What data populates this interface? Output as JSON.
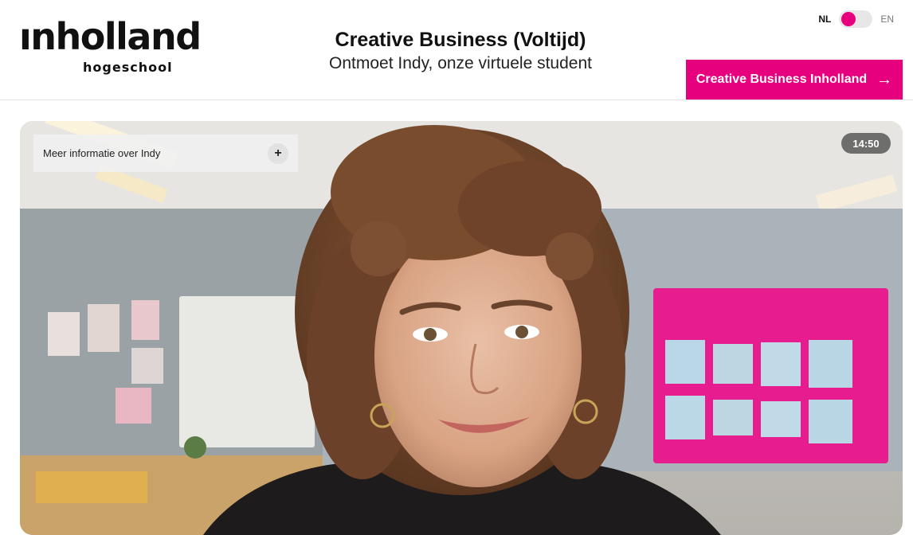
{
  "brand": {
    "logo_word": "ınholland",
    "logo_sub": "hogeschool"
  },
  "header": {
    "title": "Creative Business (Voltijd)",
    "subtitle": "Ontmoet Indy, onze virtuele student"
  },
  "language": {
    "nl_label": "NL",
    "en_label": "EN",
    "active": "NL"
  },
  "cta": {
    "label": "Creative Business Inholland",
    "icon": "arrow-right-icon"
  },
  "video": {
    "info_label": "Meer informatie over Indy",
    "info_toggle_icon": "plus-icon",
    "timer": "14:50"
  },
  "colors": {
    "accent": "#e6007e",
    "text": "#111111"
  }
}
